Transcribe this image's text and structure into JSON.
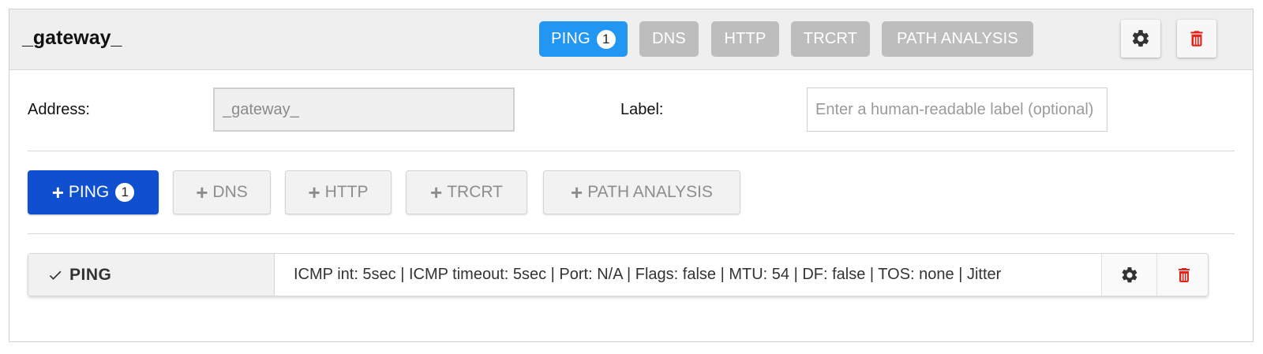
{
  "colors": {
    "active_pill": "#2196f3",
    "inactive_pill": "#bdbdbd",
    "primary_button": "#0f4fd0",
    "delete_red": "#e0261c"
  },
  "header": {
    "title": "_gateway_",
    "tabs": [
      {
        "label": "PING",
        "count": "1",
        "active": true
      },
      {
        "label": "DNS",
        "active": false
      },
      {
        "label": "HTTP",
        "active": false
      },
      {
        "label": "TRCRT",
        "active": false
      },
      {
        "label": "PATH ANALYSIS",
        "active": false
      }
    ],
    "settings_icon": "gear-icon",
    "delete_icon": "trash-icon"
  },
  "form": {
    "address_label": "Address:",
    "address_value": "_gateway_",
    "label_label": "Label:",
    "label_placeholder": "Enter a human-readable label (optional)"
  },
  "add_buttons": [
    {
      "label": "PING",
      "count": "1",
      "primary": true
    },
    {
      "label": "DNS",
      "primary": false
    },
    {
      "label": "HTTP",
      "primary": false
    },
    {
      "label": "TRCRT",
      "primary": false
    },
    {
      "label": "PATH ANALYSIS",
      "primary": false
    }
  ],
  "tests": [
    {
      "name": "PING",
      "details": "ICMP int: 5sec | ICMP timeout: 5sec | Port: N/A | Flags: false | MTU: 54 | DF: false | TOS: none | Jitter"
    }
  ]
}
